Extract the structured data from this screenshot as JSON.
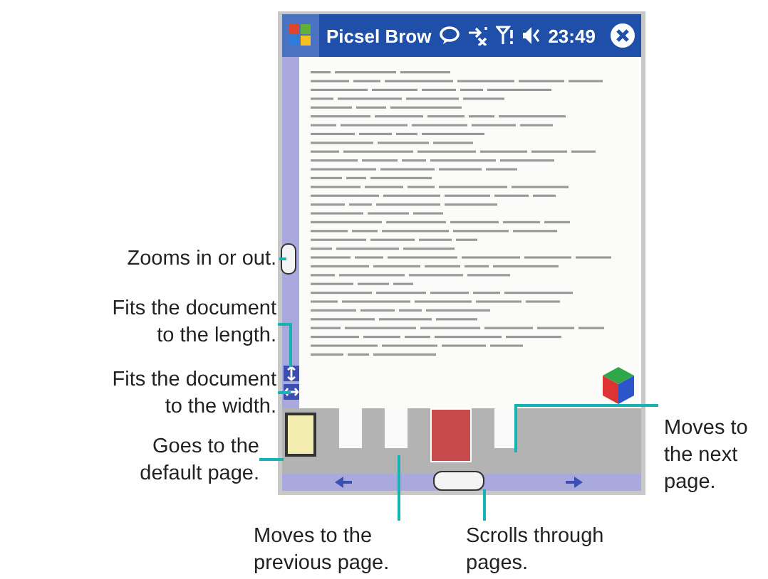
{
  "status_bar": {
    "title": "Picsel Brow",
    "time": "23:49"
  },
  "thumbnails": [
    {
      "selected": false
    },
    {
      "selected": false
    },
    {
      "selected": true
    },
    {
      "selected": false
    }
  ],
  "callouts": [
    {
      "lines": [
        "Zooms in or out."
      ]
    },
    {
      "lines": [
        "Fits the document",
        "to the length."
      ]
    },
    {
      "lines": [
        "Fits the document",
        "to the width."
      ]
    },
    {
      "lines": [
        "Goes to the",
        "default page."
      ]
    },
    {
      "lines": [
        "Moves to",
        "the next",
        "page."
      ]
    },
    {
      "lines": [
        "Moves to the",
        "previous page."
      ]
    },
    {
      "lines": [
        "Scrolls through",
        "pages."
      ]
    }
  ]
}
